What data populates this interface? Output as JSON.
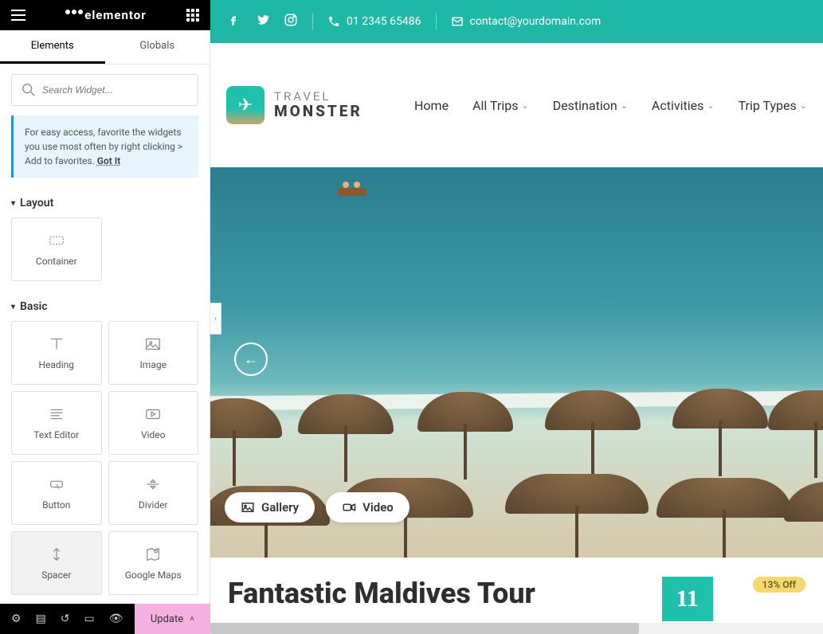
{
  "elementor": {
    "logo": "elementor",
    "tabs": {
      "elements": "Elements",
      "globals": "Globals"
    },
    "search_placeholder": "Search Widget...",
    "tip_text": "For easy access, favorite the widgets you use most often by right clicking > Add to favorites.",
    "tip_gotit": "Got It",
    "sections": {
      "layout": {
        "title": "Layout",
        "items": [
          "Container"
        ]
      },
      "basic": {
        "title": "Basic",
        "items": [
          "Heading",
          "Image",
          "Text Editor",
          "Video",
          "Button",
          "Divider",
          "Spacer",
          "Google Maps"
        ]
      }
    },
    "update_label": "Update"
  },
  "site": {
    "phone": "01 2345 65486",
    "email": "contact@yourdomain.com",
    "brand_top": "TRAVEL",
    "brand_bottom": "MONSTER",
    "nav": [
      "Home",
      "All Trips",
      "Destination",
      "Activities",
      "Trip Types"
    ],
    "gallery_label": "Gallery",
    "video_label": "Video",
    "tour_title": "Fantastic Maldives Tour",
    "days": "11",
    "discount": "13% Off"
  }
}
